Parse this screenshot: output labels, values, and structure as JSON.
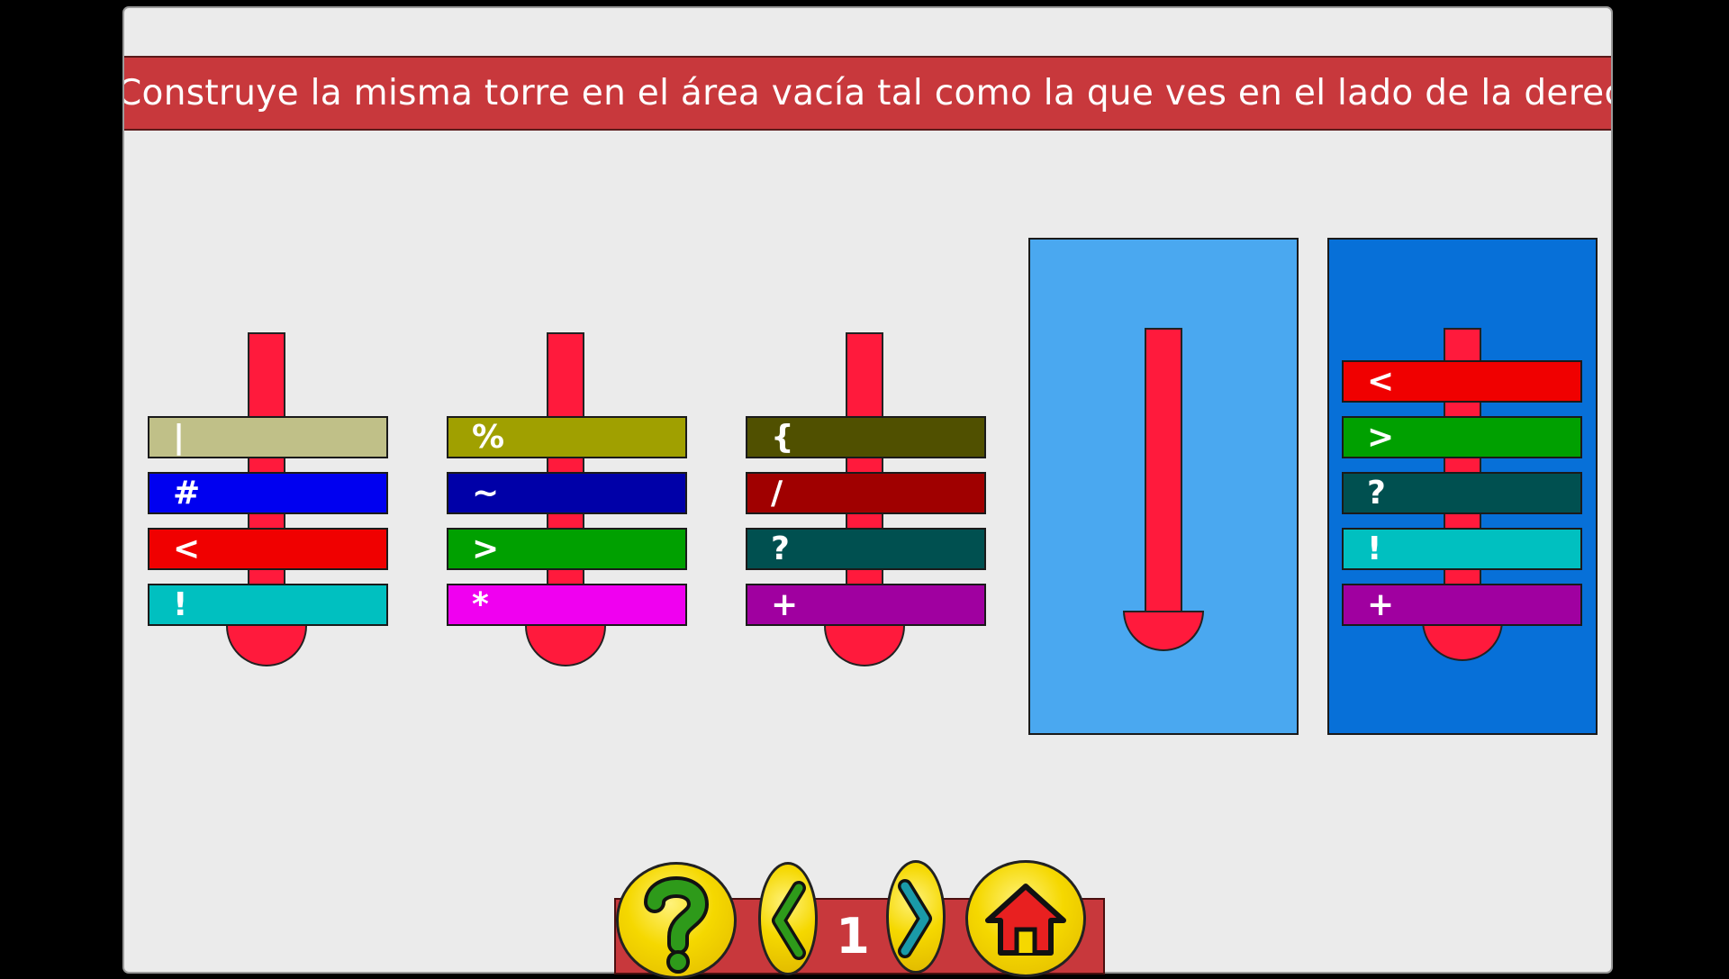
{
  "instruction": "Construye la misma torre en el área vacía tal como la que ves en el lado de la derecha",
  "towers": [
    {
      "disks": [
        {
          "symbol": "|",
          "color": "#c0c088"
        },
        {
          "symbol": "#",
          "color": "#0000f0"
        },
        {
          "symbol": "<",
          "color": "#f00000"
        },
        {
          "symbol": "!",
          "color": "#00c0c0"
        }
      ]
    },
    {
      "disks": [
        {
          "symbol": "%",
          "color": "#a0a000"
        },
        {
          "symbol": "~",
          "color": "#0000a8"
        },
        {
          "symbol": ">",
          "color": "#00a000"
        },
        {
          "symbol": "*",
          "color": "#f000f0"
        }
      ]
    },
    {
      "disks": [
        {
          "symbol": "{",
          "color": "#505000"
        },
        {
          "symbol": "/",
          "color": "#a00000"
        },
        {
          "symbol": "?",
          "color": "#005050"
        },
        {
          "symbol": "+",
          "color": "#a000a0"
        }
      ]
    }
  ],
  "target_area": {
    "color": "#4aa8f0",
    "disks": []
  },
  "model_tower": {
    "color": "#0770d8",
    "disks": [
      {
        "symbol": "<",
        "color": "#f00000"
      },
      {
        "symbol": ">",
        "color": "#00a000"
      },
      {
        "symbol": "?",
        "color": "#005050"
      },
      {
        "symbol": "!",
        "color": "#00c0c0"
      },
      {
        "symbol": "+",
        "color": "#a000a0"
      }
    ]
  },
  "nav": {
    "help_icon": "question-mark-icon",
    "prev_icon": "chevron-left-icon",
    "page_number": "1",
    "next_icon": "chevron-right-icon",
    "home_icon": "home-icon"
  }
}
